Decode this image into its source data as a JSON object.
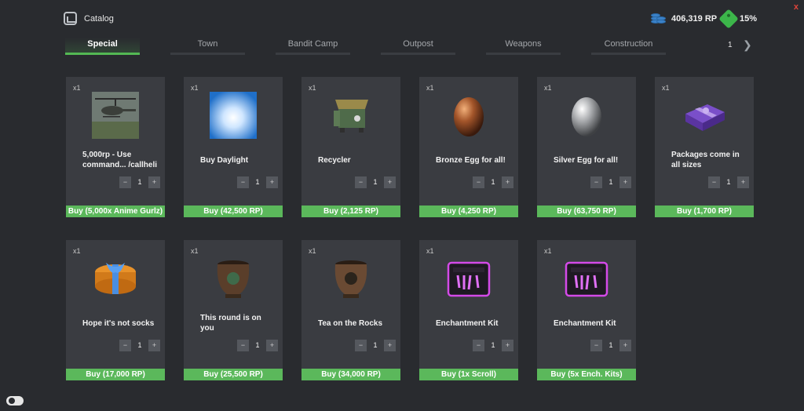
{
  "window": {
    "close_label": "x"
  },
  "header": {
    "title": "Catalog"
  },
  "balance": {
    "amount": "406,319 RP",
    "discount": "15%"
  },
  "tabs": [
    {
      "label": "Special",
      "active": true
    },
    {
      "label": "Town",
      "active": false
    },
    {
      "label": "Bandit Camp",
      "active": false
    },
    {
      "label": "Outpost",
      "active": false
    },
    {
      "label": "Weapons",
      "active": false
    },
    {
      "label": "Construction",
      "active": false
    }
  ],
  "pagination": {
    "page": "1",
    "next_icon": "chevron-right-icon"
  },
  "items": [
    {
      "qty": "x1",
      "name": "5,000rp - Use command... /callheli",
      "count": "1",
      "buy": "Buy (5,000x Anime Gurlz)",
      "icon": "helicopter-image"
    },
    {
      "qty": "x1",
      "name": "Buy Daylight",
      "count": "1",
      "buy": "Buy (42,500 RP)",
      "icon": "daylight-image"
    },
    {
      "qty": "x1",
      "name": "Recycler",
      "count": "1",
      "buy": "Buy (2,125 RP)",
      "icon": "recycler-image"
    },
    {
      "qty": "x1",
      "name": "Bronze Egg for all!",
      "count": "1",
      "buy": "Buy (4,250 RP)",
      "icon": "bronze-egg-image"
    },
    {
      "qty": "x1",
      "name": "Silver Egg for all!",
      "count": "1",
      "buy": "Buy (63,750 RP)",
      "icon": "silver-egg-image"
    },
    {
      "qty": "x1",
      "name": "Packages come in all sizes",
      "count": "1",
      "buy": "Buy (1,700 RP)",
      "icon": "purple-gift-image"
    },
    {
      "qty": "x1",
      "name": "Hope it's not socks",
      "count": "1",
      "buy": "Buy (17,000 RP)",
      "icon": "gift-box-image"
    },
    {
      "qty": "x1",
      "name": "This round is on you",
      "count": "1",
      "buy": "Buy (25,500 RP)",
      "icon": "pot-image"
    },
    {
      "qty": "x1",
      "name": "Tea on the Rocks",
      "count": "1",
      "buy": "Buy (34,000 RP)",
      "icon": "teapot-image"
    },
    {
      "qty": "x1",
      "name": "Enchantment Kit",
      "count": "1",
      "buy": "Buy (1x Scroll)",
      "icon": "enchantment-kit-image"
    },
    {
      "qty": "x1",
      "name": "Enchantment Kit",
      "count": "1",
      "buy": "Buy (5x Ench. Kits)",
      "icon": "enchantment-kit-image"
    }
  ],
  "stepper": {
    "minus": "−",
    "plus": "+"
  },
  "colors": {
    "accent": "#5bb85b",
    "background": "#292b2f",
    "card": "#3a3c41",
    "close": "#e0443a"
  }
}
